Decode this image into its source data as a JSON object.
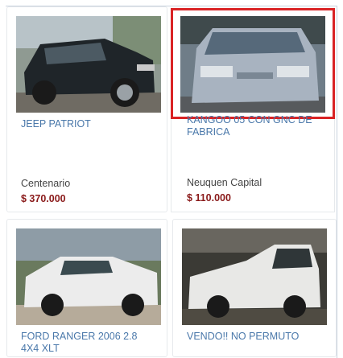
{
  "listings": [
    {
      "title": "JEEP PATRIOT",
      "location": "Centenario",
      "price": "$ 370.000",
      "image": "black-suv-photo"
    },
    {
      "title": "KANGOO 05 CON GNC DE FABRICA",
      "location": "Neuquen Capital",
      "price": "$ 110.000",
      "image": "silver-van-photo"
    },
    {
      "title": "FORD RANGER 2006 2.8 4X4 XLT",
      "location": "",
      "price": "",
      "image": "white-pickup-photo"
    },
    {
      "title": "VENDO!! NO PERMUTO",
      "location": "",
      "price": "",
      "image": "white-pickup-photo-2"
    }
  ],
  "colors": {
    "title": "#4a78aa",
    "price": "#8a1a1a",
    "highlight": "#d92325"
  }
}
